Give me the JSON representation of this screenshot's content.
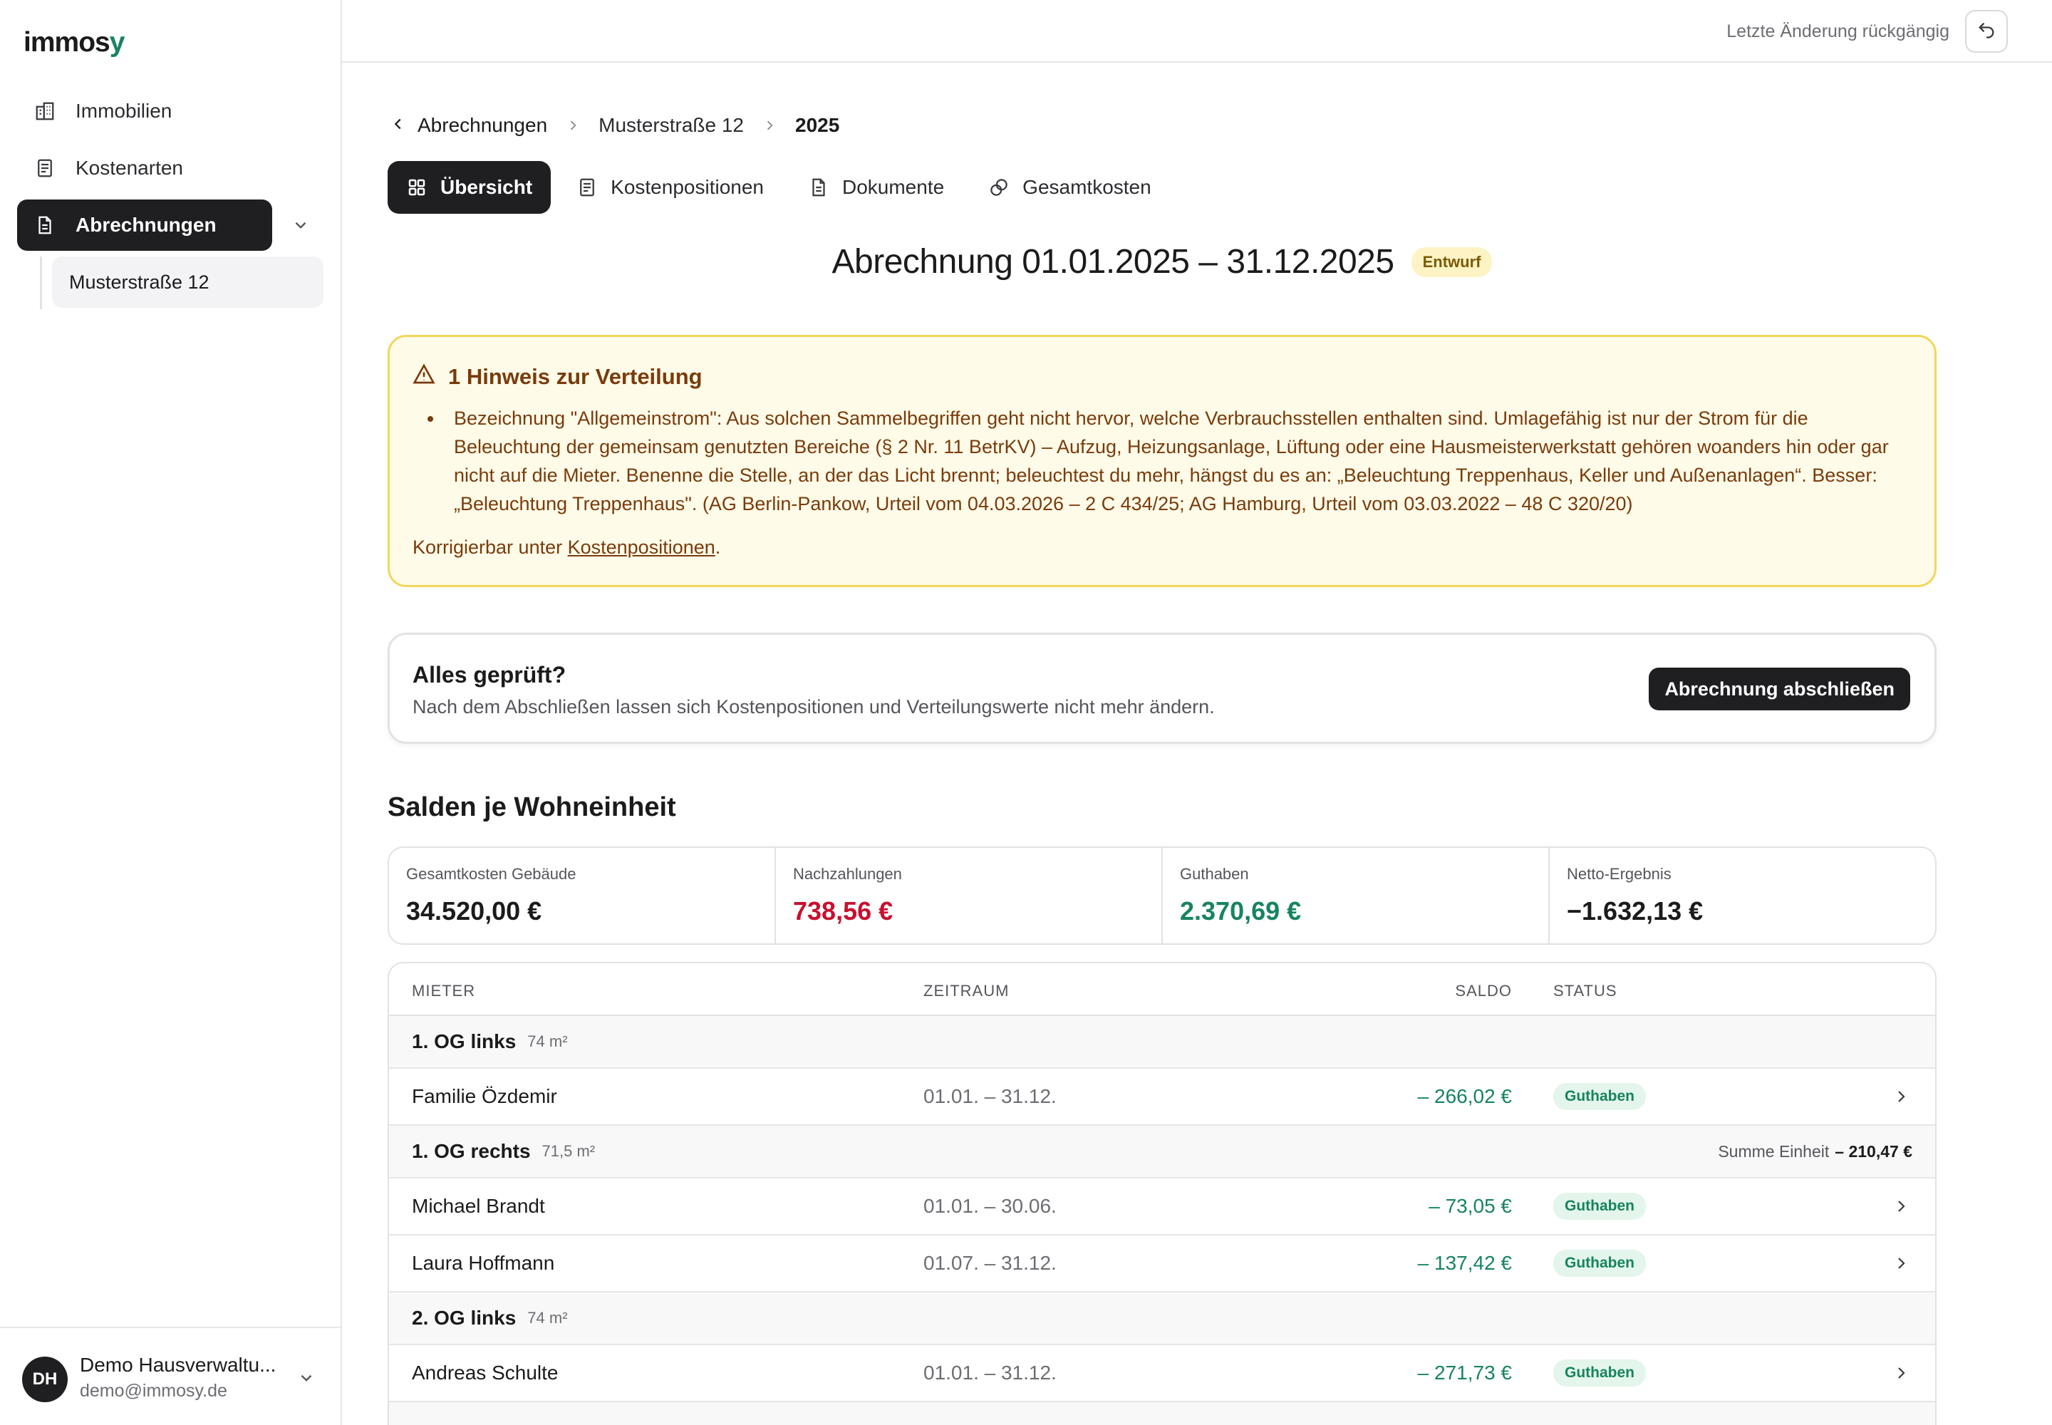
{
  "app": {
    "logo_main": "immos",
    "logo_accent": "y"
  },
  "sidebar": {
    "items": [
      {
        "label": "Immobilien",
        "icon": "building-icon"
      },
      {
        "label": "Kostenarten",
        "icon": "receipt-icon"
      },
      {
        "label": "Abrechnungen",
        "icon": "document-icon",
        "active": true
      }
    ],
    "subitems": [
      {
        "label": "Musterstraße 12"
      }
    ],
    "user": {
      "initials": "DH",
      "name": "Demo Hausverwaltu...",
      "email": "demo@immosy.de"
    }
  },
  "topbar": {
    "undo_label": "Letzte Änderung rückgängig"
  },
  "breadcrumb": {
    "back": "Abrechnungen",
    "middle": "Musterstraße 12",
    "current": "2025"
  },
  "tabs": [
    {
      "label": "Übersicht",
      "icon": "grid-icon",
      "active": true
    },
    {
      "label": "Kostenpositionen",
      "icon": "receipt-icon"
    },
    {
      "label": "Dokumente",
      "icon": "file-icon"
    },
    {
      "label": "Gesamtkosten",
      "icon": "coins-icon"
    }
  ],
  "header": {
    "title": "Abrechnung 01.01.2025 – 31.12.2025",
    "badge": "Entwurf"
  },
  "warning": {
    "title": "1 Hinweis zur Verteilung",
    "items": [
      "Bezeichnung \"Allgemeinstrom\": Aus solchen Sammelbegriffen geht nicht hervor, welche Verbrauchsstellen enthalten sind. Umlagefähig ist nur der Strom für die Beleuchtung der gemeinsam genutzten Bereiche (§ 2 Nr. 11 BetrKV) – Aufzug, Heizungsanlage, Lüftung oder eine Hausmeisterwerkstatt gehören woanders hin oder gar nicht auf die Mieter. Benenne die Stelle, an der das Licht brennt; beleuchtest du mehr, hängst du es an: „Beleuchtung Treppenhaus, Keller und Außenanlagen“. Besser: „Beleuchtung Treppenhaus\". (AG Berlin-Pankow, Urteil vom 04.03.2026 – 2 C 434/25; AG Hamburg, Urteil vom 03.03.2022 – 48 C 320/20)"
    ],
    "footer_prefix": "Korrigierbar unter ",
    "footer_link": "Kostenpositionen",
    "footer_suffix": "."
  },
  "check": {
    "title": "Alles geprüft?",
    "subtitle": "Nach dem Abschließen lassen sich Kostenpositionen und Verteilungswerte nicht mehr ändern.",
    "button": "Abrechnung abschließen"
  },
  "balances": {
    "title": "Salden je Wohneinheit",
    "stats": [
      {
        "label": "Gesamtkosten Gebäude",
        "value": "34.520,00 €",
        "tone": "neutral"
      },
      {
        "label": "Nachzahlungen",
        "value": "738,56 €",
        "tone": "negative"
      },
      {
        "label": "Guthaben",
        "value": "2.370,69 €",
        "tone": "positive"
      },
      {
        "label": "Netto-Ergebnis",
        "value": "−1.632,13 €",
        "tone": "neutral"
      }
    ],
    "columns": {
      "tenant": "MIETER",
      "period": "ZEITRAUM",
      "saldo": "SALDO",
      "status": "STATUS"
    },
    "rows": [
      {
        "type": "group",
        "name": "1. OG links",
        "area": "74 m²"
      },
      {
        "type": "tenant",
        "name": "Familie Özdemir",
        "period": "01.01. – 31.12.",
        "saldo": "– 266,02 €",
        "status": "Guthaben"
      },
      {
        "type": "group",
        "name": "1. OG rechts",
        "area": "71,5 m²",
        "sum_label": "Summe Einheit",
        "sum_value": "– 210,47 €"
      },
      {
        "type": "tenant",
        "name": "Michael Brandt",
        "period": "01.01. – 30.06.",
        "saldo": "– 73,05 €",
        "status": "Guthaben"
      },
      {
        "type": "tenant",
        "name": "Laura Hoffmann",
        "period": "01.07. – 31.12.",
        "saldo": "– 137,42 €",
        "status": "Guthaben"
      },
      {
        "type": "group",
        "name": "2. OG links",
        "area": "74 m²"
      },
      {
        "type": "tenant",
        "name": "Andreas Schulte",
        "period": "01.01. – 31.12.",
        "saldo": "– 271,73 €",
        "status": "Guthaben"
      }
    ]
  },
  "colors": {
    "accent": "#17845e",
    "dark": "#1f1f22",
    "negative": "#c8102e",
    "warning_bg": "#fefbe8",
    "warning_border": "#f3d65a",
    "warning_text": "#7a3b0c"
  }
}
